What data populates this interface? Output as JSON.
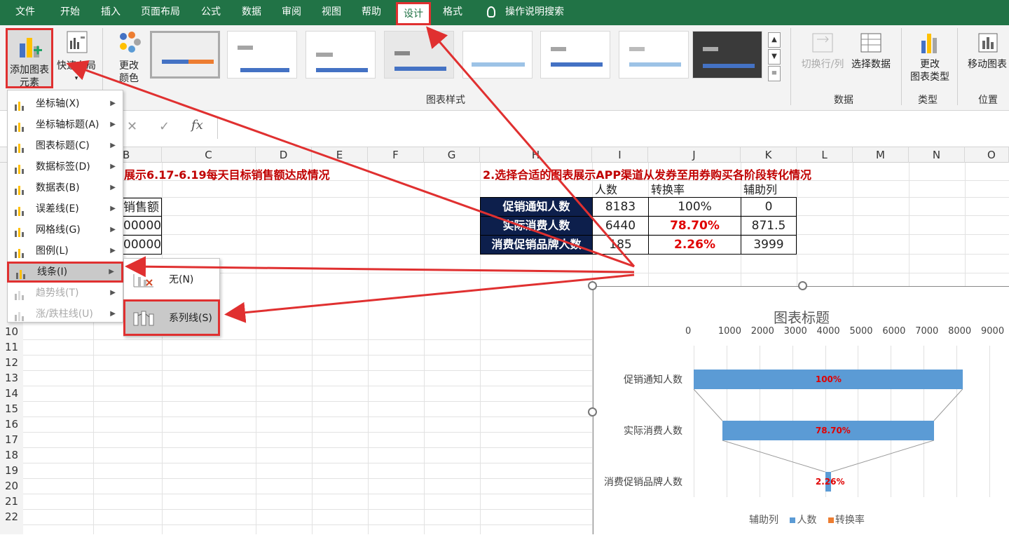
{
  "tabs": {
    "file": "文件",
    "home": "开始",
    "insert": "插入",
    "layout": "页面布局",
    "formulas": "公式",
    "data": "数据",
    "review": "审阅",
    "view": "视图",
    "help": "帮助",
    "design": "设计",
    "format": "格式",
    "tell_me": "操作说明搜索"
  },
  "ribbon": {
    "add_element": "添加图表",
    "add_element2": "元素",
    "quick_layout": "快速布局",
    "change_colors": "更改",
    "change_colors2": "颜色",
    "chart_styles_group": "图表样式",
    "switch_rowcol": "切换行/列",
    "select_data": "选择数据",
    "data_group": "数据",
    "change_type": "更改",
    "change_type2": "图表类型",
    "type_group": "类型",
    "move_chart": "移动图表",
    "location_group": "位置"
  },
  "formula": {
    "fx": "fx"
  },
  "columns": [
    "B",
    "C",
    "D",
    "E",
    "F",
    "G",
    "H",
    "I",
    "J",
    "K",
    "L",
    "M",
    "N",
    "O"
  ],
  "rows": [
    "10",
    "11",
    "12",
    "13",
    "14",
    "15",
    "16",
    "17",
    "18",
    "19",
    "20",
    "21"
  ],
  "sheet": {
    "title1": "展示6.17-6.19每天目标销售额达成情况",
    "title2": "2.选择合适的图表展示APP渠道从发券至用券购买各阶段转化情况",
    "b_header": "销售额",
    "b_r1": "00000",
    "b_r2": "00000",
    "table": {
      "headers": [
        "人数",
        "转换率",
        "辅助列"
      ],
      "rows": [
        {
          "label": "促销通知人数",
          "count": "8183",
          "rate": "100%",
          "aux": "0"
        },
        {
          "label": "实际消费人数",
          "count": "6440",
          "rate": "78.70%",
          "aux": "871.5"
        },
        {
          "label": "消费促销品牌人数",
          "count": "185",
          "rate": "2.26%",
          "aux": "3999"
        }
      ]
    }
  },
  "menu": {
    "items": [
      {
        "label": "坐标轴(X)",
        "icon": "axis-icon"
      },
      {
        "label": "坐标轴标题(A)",
        "icon": "axis-title-icon"
      },
      {
        "label": "图表标题(C)",
        "icon": "chart-title-icon"
      },
      {
        "label": "数据标签(D)",
        "icon": "data-labels-icon"
      },
      {
        "label": "数据表(B)",
        "icon": "data-table-icon"
      },
      {
        "label": "误差线(E)",
        "icon": "error-bars-icon"
      },
      {
        "label": "网格线(G)",
        "icon": "gridlines-icon"
      },
      {
        "label": "图例(L)",
        "icon": "legend-icon"
      },
      {
        "label": "线条(I)",
        "icon": "lines-icon"
      },
      {
        "label": "趋势线(T)",
        "icon": "trendline-icon"
      },
      {
        "label": "涨/跌柱线(U)",
        "icon": "updown-bars-icon"
      }
    ],
    "submenu": [
      {
        "label": "无(N)"
      },
      {
        "label": "系列线(S)"
      }
    ]
  },
  "chart_data": {
    "type": "bar",
    "title": "图表标题",
    "categories": [
      "促销通知人数",
      "实际消费人数",
      "消费促销品牌人数"
    ],
    "series": [
      {
        "name": "辅助列",
        "values": [
          0,
          871.5,
          3999
        ],
        "color": "transparent"
      },
      {
        "name": "人数",
        "values": [
          8183,
          6440,
          185
        ],
        "color": "#5b9bd5"
      },
      {
        "name": "转换率",
        "values": [
          1.0,
          0.787,
          0.0226
        ],
        "color": "#ed7d31"
      }
    ],
    "data_labels": [
      "100%",
      "78.70%",
      "2.26%"
    ],
    "xlim": [
      0,
      9000
    ],
    "xticks": [
      "0",
      "1000",
      "2000",
      "3000",
      "4000",
      "5000",
      "6000",
      "7000",
      "8000",
      "9000"
    ],
    "legend": [
      "辅助列",
      "人数",
      "转换率"
    ],
    "legend_position": "bottom",
    "series_lines": true
  },
  "colors": {
    "excel_green": "#217346",
    "annotation_red": "#e03030",
    "title_red": "#c00000",
    "navy": "#0d1f4c",
    "bar_blue": "#5b9bd5",
    "orange": "#ed7d31"
  }
}
